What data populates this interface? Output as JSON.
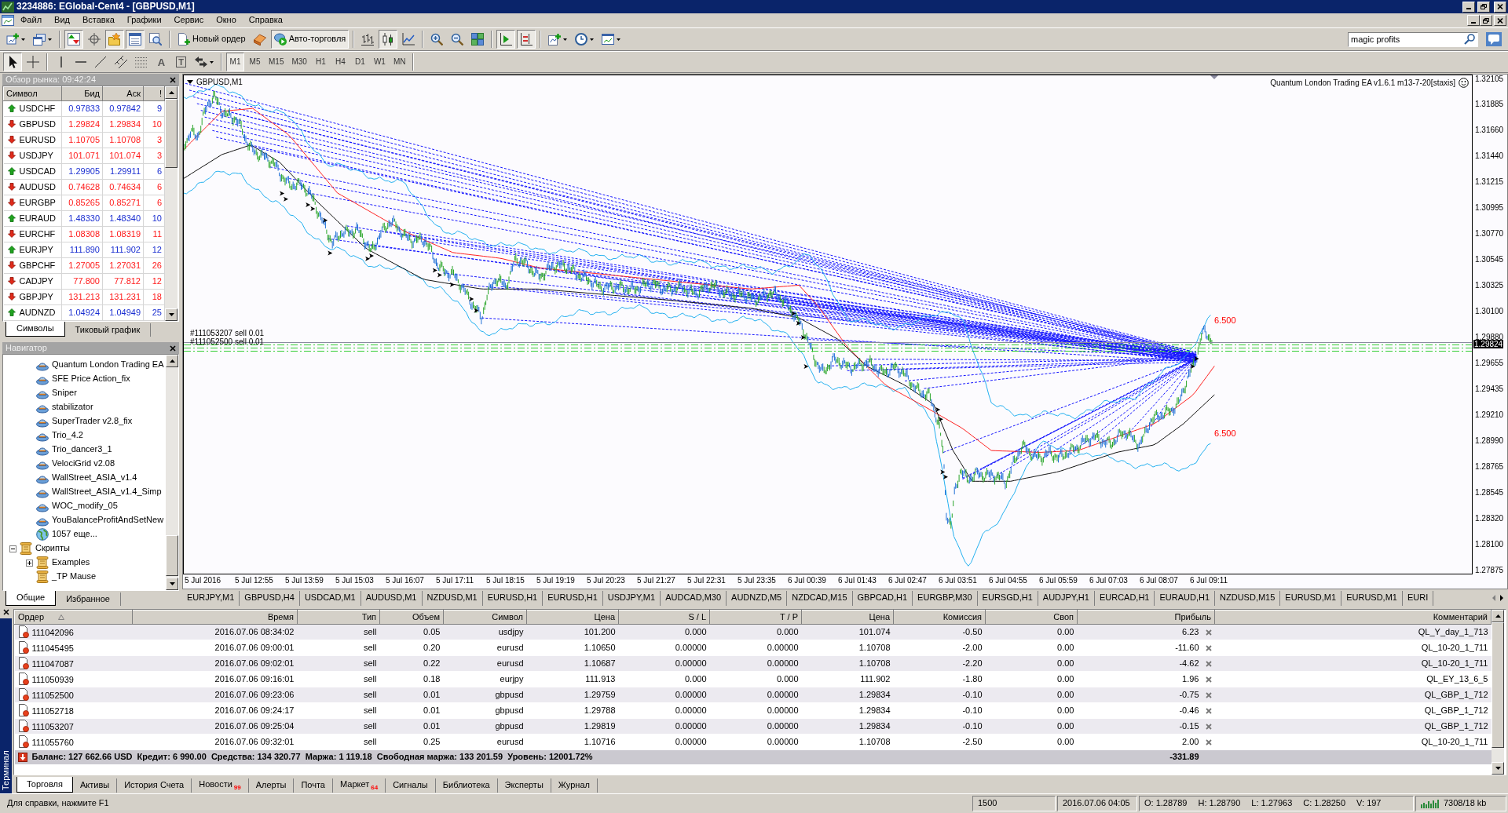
{
  "window": {
    "title": "3234886: EGlobal-Cent4 - [GBPUSD,M1]"
  },
  "menu": [
    "Файл",
    "Вид",
    "Вставка",
    "Графики",
    "Сервис",
    "Окно",
    "Справка"
  ],
  "toolbar": {
    "items": [
      {
        "kind": "new-chart",
        "dropdown": true,
        "pressed": false
      },
      {
        "kind": "profiles",
        "dropdown": true,
        "pressed": false
      },
      {
        "kind": "separator"
      },
      {
        "kind": "market-watch",
        "pressed": true
      },
      {
        "kind": "data-window",
        "pressed": false
      },
      {
        "kind": "navigator",
        "pressed": true
      },
      {
        "kind": "terminal",
        "pressed": true
      },
      {
        "kind": "tester",
        "pressed": false
      },
      {
        "kind": "separator"
      },
      {
        "kind": "new-order",
        "label": "Новый ордер",
        "pressed": false
      },
      {
        "kind": "editor",
        "pressed": false
      },
      {
        "kind": "auto-trading",
        "label": "Авто-торговля",
        "pressed": true
      },
      {
        "kind": "separator"
      },
      {
        "kind": "bars",
        "pressed": false
      },
      {
        "kind": "candles",
        "pressed": true
      },
      {
        "kind": "line",
        "pressed": false
      },
      {
        "kind": "separator"
      },
      {
        "kind": "zoom-in",
        "pressed": false
      },
      {
        "kind": "zoom-out",
        "pressed": false
      },
      {
        "kind": "tile",
        "pressed": false
      },
      {
        "kind": "separator"
      },
      {
        "kind": "autoscroll",
        "pressed": true
      },
      {
        "kind": "shift",
        "pressed": true
      },
      {
        "kind": "separator"
      },
      {
        "kind": "indicators",
        "dropdown": true,
        "pressed": false
      },
      {
        "kind": "periods",
        "dropdown": true,
        "pressed": false
      },
      {
        "kind": "templates",
        "dropdown": true,
        "pressed": false
      }
    ],
    "search": {
      "value": "magic profits"
    }
  },
  "drawing_toolbar": {
    "items": [
      {
        "kind": "cursor",
        "pressed": true
      },
      {
        "kind": "crosshair",
        "pressed": false
      },
      {
        "kind": "separator"
      },
      {
        "kind": "vline",
        "pressed": false
      },
      {
        "kind": "hline",
        "pressed": false
      },
      {
        "kind": "trendline",
        "pressed": false
      },
      {
        "kind": "channel",
        "pressed": false
      },
      {
        "kind": "fibo",
        "pressed": false
      },
      {
        "kind": "glyph",
        "label": "A",
        "pressed": false
      },
      {
        "kind": "framed-glyph",
        "label": "T",
        "pressed": false
      },
      {
        "kind": "arrows",
        "dropdown": true,
        "pressed": false
      },
      {
        "kind": "separator"
      }
    ],
    "periods": [
      {
        "label": "M1",
        "selected": true
      },
      {
        "label": "M5",
        "selected": false
      },
      {
        "label": "M15",
        "selected": false
      },
      {
        "label": "M30",
        "selected": false
      },
      {
        "label": "H1",
        "selected": false
      },
      {
        "label": "H4",
        "selected": false
      },
      {
        "label": "D1",
        "selected": false
      },
      {
        "label": "W1",
        "selected": false
      },
      {
        "label": "MN",
        "selected": false
      }
    ]
  },
  "market_watch": {
    "title": "Обзор рынка: 09:42:24",
    "columns": [
      "Символ",
      "Бид",
      "Аск",
      "!"
    ],
    "rows": [
      {
        "symbol": "USDCHF",
        "rising": true,
        "bid": "0.97833",
        "ask": "0.97842",
        "spread": "9"
      },
      {
        "symbol": "GBPUSD",
        "rising": false,
        "bid": "1.29824",
        "ask": "1.29834",
        "spread": "10"
      },
      {
        "symbol": "EURUSD",
        "rising": false,
        "bid": "1.10705",
        "ask": "1.10708",
        "spread": "3"
      },
      {
        "symbol": "USDJPY",
        "rising": false,
        "bid": "101.071",
        "ask": "101.074",
        "spread": "3"
      },
      {
        "symbol": "USDCAD",
        "rising": true,
        "bid": "1.29905",
        "ask": "1.29911",
        "spread": "6"
      },
      {
        "symbol": "AUDUSD",
        "rising": false,
        "bid": "0.74628",
        "ask": "0.74634",
        "spread": "6"
      },
      {
        "symbol": "EURGBP",
        "rising": false,
        "bid": "0.85265",
        "ask": "0.85271",
        "spread": "6"
      },
      {
        "symbol": "EURAUD",
        "rising": true,
        "bid": "1.48330",
        "ask": "1.48340",
        "spread": "10"
      },
      {
        "symbol": "EURCHF",
        "rising": false,
        "bid": "1.08308",
        "ask": "1.08319",
        "spread": "11"
      },
      {
        "symbol": "EURJPY",
        "rising": true,
        "bid": "111.890",
        "ask": "111.902",
        "spread": "12"
      },
      {
        "symbol": "GBPCHF",
        "rising": false,
        "bid": "1.27005",
        "ask": "1.27031",
        "spread": "26"
      },
      {
        "symbol": "CADJPY",
        "rising": false,
        "bid": "77.800",
        "ask": "77.812",
        "spread": "12"
      },
      {
        "symbol": "GBPJPY",
        "rising": false,
        "bid": "131.213",
        "ask": "131.231",
        "spread": "18"
      },
      {
        "symbol": "AUDNZD",
        "rising": true,
        "bid": "1.04924",
        "ask": "1.04949",
        "spread": "25"
      }
    ],
    "tabs": [
      {
        "label": "Символы",
        "selected": true
      },
      {
        "label": "Тиковый график",
        "selected": false
      }
    ]
  },
  "navigator": {
    "title": "Навигатор",
    "expert_items": [
      {
        "kind": "expert",
        "label": "Quantum London Trading EA"
      },
      {
        "kind": "expert",
        "label": "SFE Price Action_fix"
      },
      {
        "kind": "expert",
        "label": "Sniper"
      },
      {
        "kind": "expert",
        "label": "stabilizator"
      },
      {
        "kind": "expert",
        "label": "SuperTrader v2.8_fix"
      },
      {
        "kind": "expert",
        "label": "Trio_4.2"
      },
      {
        "kind": "expert",
        "label": "Trio_dancer3_1"
      },
      {
        "kind": "expert",
        "label": "VelociGrid v2.08"
      },
      {
        "kind": "expert",
        "label": "WallStreet_ASIA_v1.4"
      },
      {
        "kind": "expert",
        "label": "WallStreet_ASIA_v1.4_Simp"
      },
      {
        "kind": "expert",
        "label": "WOC_modify_05"
      },
      {
        "kind": "expert",
        "label": "YouBalanceProfitAndSetNew"
      },
      {
        "kind": "more",
        "label": "1057 еще..."
      }
    ],
    "folders": [
      {
        "label": "Скрипты",
        "expanded": true,
        "children": [
          {
            "label": "Examples",
            "expanded": false
          },
          {
            "label": "_TP Mause"
          }
        ]
      }
    ],
    "tabs": [
      {
        "label": "Общие",
        "selected": true
      },
      {
        "label": "Избранное",
        "selected": false
      }
    ]
  },
  "chart": {
    "symbol_label": "GBPUSD,M1",
    "expert_label": "Quantum London Trading EA v1.6.1 m13-7-20[staxis]",
    "price_labels": [
      "1.32105",
      "1.31885",
      "1.31660",
      "1.31440",
      "1.31215",
      "1.30995",
      "1.30770",
      "1.30545",
      "1.30325",
      "1.30100",
      "1.29880",
      "1.29655",
      "1.29435",
      "1.29210",
      "1.28990",
      "1.28765",
      "1.28545",
      "1.28320",
      "1.28100",
      "1.27875"
    ],
    "current_price": "1.29824",
    "time_labels": [
      "5 Jul 2016",
      "5 Jul 12:55",
      "5 Jul 13:59",
      "5 Jul 15:03",
      "5 Jul 16:07",
      "5 Jul 17:11",
      "5 Jul 18:15",
      "5 Jul 19:19",
      "5 Jul 20:23",
      "5 Jul 21:27",
      "5 Jul 22:31",
      "5 Jul 23:35",
      "6 Jul 00:39",
      "6 Jul 01:43",
      "6 Jul 02:47",
      "6 Jul 03:51",
      "6 Jul 04:55",
      "6 Jul 05:59",
      "6 Jul 07:03",
      "6 Jul 08:07",
      "6 Jul 09:11"
    ],
    "order_labels": [
      "#111053207 sell 0.01",
      "#111052500 sell 0.01"
    ],
    "level_labels": [
      "6.500",
      "6.500"
    ]
  },
  "chart_tabs": [
    "EURJPY,M1",
    "GBPUSD,H4",
    "USDCAD,M1",
    "AUDUSD,M1",
    "NZDUSD,M1",
    "EURUSD,H1",
    "EURUSD,H1",
    "USDJPY,M1",
    "AUDCAD,M30",
    "AUDNZD,M5",
    "NZDCAD,M15",
    "GBPCAD,H1",
    "EURGBP,M30",
    "EURSGD,H1",
    "AUDJPY,H1",
    "EURCAD,H1",
    "EURAUD,H1",
    "NZDUSD,M15",
    "EURUSD,M1",
    "EURUSD,M1",
    "EURI"
  ],
  "terminal": {
    "title": "Терминал",
    "columns": [
      "Ордер",
      "Время",
      "Тип",
      "Объем",
      "Символ",
      "Цена",
      "S / L",
      "T / P",
      "Цена",
      "Комиссия",
      "Своп",
      "Прибыль",
      "Комментарий"
    ],
    "rows": [
      {
        "cells": [
          "111042096",
          "2016.07.06 08:34:02",
          "sell",
          "0.05",
          "usdjpy",
          "101.200",
          "0.000",
          "0.000",
          "101.074",
          "-0.50",
          "0.00",
          "6.23",
          "QL_Y_day_1_713"
        ]
      },
      {
        "cells": [
          "111045495",
          "2016.07.06 09:00:01",
          "sell",
          "0.20",
          "eurusd",
          "1.10650",
          "0.00000",
          "0.00000",
          "1.10708",
          "-2.00",
          "0.00",
          "-11.60",
          "QL_10-20_1_711"
        ]
      },
      {
        "cells": [
          "111047087",
          "2016.07.06 09:02:01",
          "sell",
          "0.22",
          "eurusd",
          "1.10687",
          "0.00000",
          "0.00000",
          "1.10708",
          "-2.20",
          "0.00",
          "-4.62",
          "QL_10-20_1_711"
        ]
      },
      {
        "cells": [
          "111050939",
          "2016.07.06 09:16:01",
          "sell",
          "0.18",
          "eurjpy",
          "111.913",
          "0.000",
          "0.000",
          "111.902",
          "-1.80",
          "0.00",
          "1.96",
          "QL_EY_13_6_5"
        ]
      },
      {
        "cells": [
          "111052500",
          "2016.07.06 09:23:06",
          "sell",
          "0.01",
          "gbpusd",
          "1.29759",
          "0.00000",
          "0.00000",
          "1.29834",
          "-0.10",
          "0.00",
          "-0.75",
          "QL_GBP_1_712"
        ]
      },
      {
        "cells": [
          "111052718",
          "2016.07.06 09:24:17",
          "sell",
          "0.01",
          "gbpusd",
          "1.29788",
          "0.00000",
          "0.00000",
          "1.29834",
          "-0.10",
          "0.00",
          "-0.46",
          "QL_GBP_1_712"
        ]
      },
      {
        "cells": [
          "111053207",
          "2016.07.06 09:25:04",
          "sell",
          "0.01",
          "gbpusd",
          "1.29819",
          "0.00000",
          "0.00000",
          "1.29834",
          "-0.10",
          "0.00",
          "-0.15",
          "QL_GBP_1_712"
        ]
      },
      {
        "cells": [
          "111055760",
          "2016.07.06 09:32:01",
          "sell",
          "0.25",
          "eurusd",
          "1.10716",
          "0.00000",
          "0.00000",
          "1.10708",
          "-2.50",
          "0.00",
          "2.00",
          "QL_10-20_1_711"
        ]
      }
    ],
    "summary": {
      "text": "Баланс: 127 662.66 USD  Кредит: 6 990.00  Средства: 134 320.77  Маржа: 1 119.18  Свободная маржа: 133 201.59  Уровень: 12001.72%",
      "profit": "-331.89"
    },
    "tabs": [
      {
        "label": "Торговля",
        "selected": true
      },
      {
        "label": "Активы",
        "selected": false
      },
      {
        "label": "История Счета",
        "selected": false
      },
      {
        "label": "Новости",
        "badge": "99",
        "selected": false
      },
      {
        "label": "Алерты",
        "selected": false
      },
      {
        "label": "Почта",
        "selected": false
      },
      {
        "label": "Маркет",
        "badge": "64",
        "selected": false
      },
      {
        "label": "Сигналы",
        "selected": false
      },
      {
        "label": "Библиотека",
        "selected": false
      },
      {
        "label": "Эксперты",
        "selected": false
      },
      {
        "label": "Журнал",
        "selected": false
      }
    ]
  },
  "status_bar": {
    "help": "Для справки, нажмите F1",
    "cells": [
      "1500",
      "2016.07.06 04:05"
    ],
    "quote": [
      "O: 1.28789",
      "H: 1.28790",
      "L: 1.27963",
      "C: 1.28250",
      "V: 197"
    ],
    "traffic": "7308/18 kb"
  }
}
